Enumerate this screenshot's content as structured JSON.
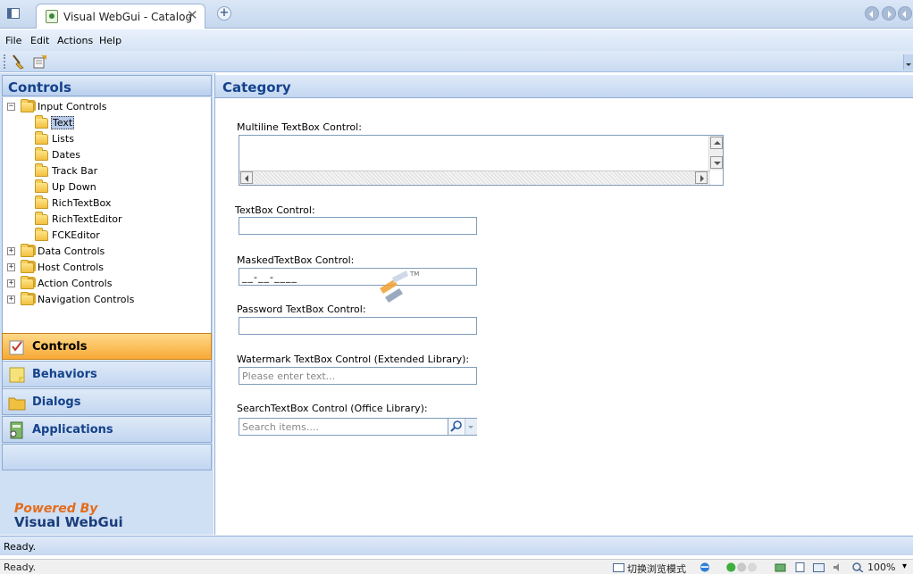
{
  "browser": {
    "tab_title": "Visual WebGui - Catalog",
    "close_glyph": "✕",
    "newtab_glyph": "+",
    "status_text": "Ready.",
    "mode_text": "切换浏览模式",
    "zoom": "100%",
    "zoom_caret": "▾"
  },
  "menu": {
    "items": [
      "File",
      "Edit",
      "Actions",
      "Help"
    ]
  },
  "left_panel": {
    "title": "Controls",
    "tree": [
      {
        "label": "Input Controls",
        "expanded": true,
        "glyph": "−"
      },
      {
        "label": "Text",
        "selected": true
      },
      {
        "label": "Lists"
      },
      {
        "label": "Dates"
      },
      {
        "label": "Track Bar"
      },
      {
        "label": "Up Down"
      },
      {
        "label": "RichTextBox"
      },
      {
        "label": "RichTextEditor"
      },
      {
        "label": "FCKEditor"
      },
      {
        "label": "Data Controls",
        "glyph": "+"
      },
      {
        "label": "Host Controls",
        "glyph": "+"
      },
      {
        "label": "Action Controls",
        "glyph": "+"
      },
      {
        "label": "Navigation Controls",
        "glyph": "+"
      }
    ],
    "nav_buttons": [
      {
        "label": "Controls",
        "icon": "checklist-icon",
        "active": true
      },
      {
        "label": "Behaviors",
        "icon": "note-icon"
      },
      {
        "label": "Dialogs",
        "icon": "folder-icon"
      },
      {
        "label": "Applications",
        "icon": "app-icon"
      }
    ],
    "powered_by": "Powered By",
    "brand": "Visual WebGui"
  },
  "category": {
    "title": "Category",
    "multiline_label": "Multiline TextBox Control:",
    "textbox_label": "TextBox Control:",
    "masked_label": "MaskedTextBox Control:",
    "masked_value": "__-__-____",
    "password_label": "Password TextBox Control:",
    "watermark_label": "Watermark TextBox Control (Extended Library):",
    "watermark_placeholder": "Please enter text...",
    "search_label": "SearchTextBox Control (Office Library):",
    "search_placeholder": "Search items....",
    "tm": "TM"
  },
  "status": {
    "text": "Ready."
  },
  "colors": {
    "header_text": "#15428b",
    "active_nav": "#f7a935",
    "powered": "#e46c1a"
  }
}
